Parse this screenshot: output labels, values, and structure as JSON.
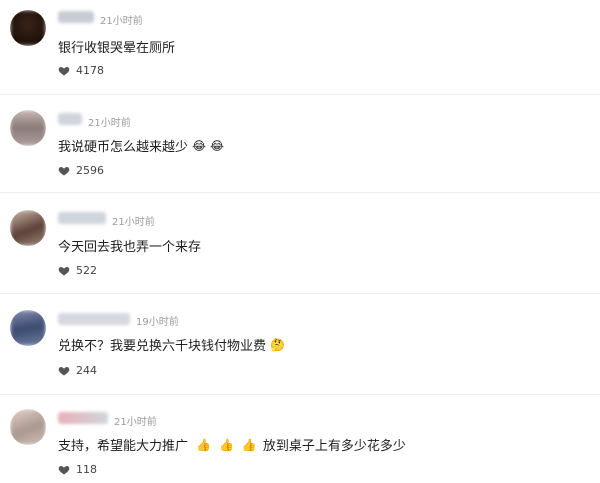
{
  "comments": [
    {
      "time": "21小时前",
      "text": "银行收银哭晕在厕所",
      "emojis": [],
      "likes": "4178",
      "avatar_colors": [
        "#2a1a12",
        "#3a2418"
      ]
    },
    {
      "time": "21小时前",
      "text": "我说硬币怎么越来越少",
      "emojis": [
        "😂",
        "😂"
      ],
      "likes": "2596",
      "avatar_colors": [
        "#9a9090",
        "#c8b8b0"
      ]
    },
    {
      "time": "21小时前",
      "text": "今天回去我也弄一个来存",
      "emojis": [],
      "likes": "522",
      "avatar_colors": [
        "#6a5048",
        "#b09080"
      ]
    },
    {
      "time": "19小时前",
      "text": "兑换不？我要兑换六千块钱付物业费",
      "emojis": [
        "🤔"
      ],
      "likes": "244",
      "avatar_colors": [
        "#4a5a80",
        "#8890b0"
      ]
    },
    {
      "time": "21小时前",
      "text_before": "支持，希望能大力推广",
      "emojis": [
        "👍",
        "👍",
        "👍"
      ],
      "text_after": "放到桌子上有多少花多少",
      "likes": "118",
      "avatar_colors": [
        "#d0b0a8",
        "#9a8a88"
      ]
    }
  ]
}
